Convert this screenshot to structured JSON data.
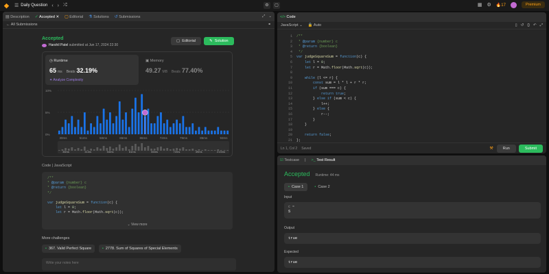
{
  "topbar": {
    "title": "Daily Question",
    "fire_count": "17",
    "premium": "Premium"
  },
  "left_tabs": [
    {
      "label": "Description"
    },
    {
      "label": "Accepted"
    },
    {
      "label": "Editorial"
    },
    {
      "label": "Solutions"
    },
    {
      "label": "Submissions"
    }
  ],
  "all_submissions": "All Submissions",
  "result": {
    "status": "Accepted",
    "user": "Harshil Patel",
    "submitted": "submitted at Jun 17, 2024 22:30",
    "editorial_btn": "Editorial",
    "solution_btn": "Solution"
  },
  "runtime": {
    "label": "Runtime",
    "value": "65",
    "unit": "ms",
    "beats_label": "Beats",
    "beats": "32.19%",
    "analyze": "Analyze Complexity"
  },
  "memory": {
    "label": "Memory",
    "value": "49.27",
    "unit": "MB",
    "beats_label": "Beats",
    "beats": "77.40%"
  },
  "chart_data": {
    "type": "bar",
    "y_ticks": [
      "10%",
      "5%",
      "0%"
    ],
    "x_ticks": [
      "30ms",
      "51ms",
      "58ms",
      "65ms",
      "86ms",
      "72ms",
      "79ms",
      "86ms",
      "93ms"
    ],
    "values": [
      1,
      2,
      4,
      3,
      5,
      2,
      4,
      2,
      6,
      1,
      3,
      2,
      5,
      3,
      7,
      4,
      6,
      3,
      5,
      9,
      4,
      6,
      2,
      7,
      10,
      6,
      11,
      5,
      7,
      3,
      3,
      5,
      6,
      3,
      4,
      2,
      3,
      4,
      3,
      5,
      2,
      2,
      3,
      1,
      2,
      1,
      2,
      1,
      1,
      1,
      2,
      1,
      1,
      1
    ],
    "highlight_index": 27,
    "ylim": [
      0,
      12
    ],
    "mini_x_ticks": [
      "36ms",
      "41ms",
      "54ms",
      "61ms",
      "66ms",
      "72ms",
      "49ms",
      "213ms"
    ]
  },
  "code_section": {
    "label": "Code",
    "lang": "JavaScript",
    "view_more": "View more"
  },
  "more": {
    "label": "More challenges",
    "c1": "367. Valid Perfect Square",
    "c2": "2778. Sum of Squares of Special Elements",
    "notes_placeholder": "Write your notes here"
  },
  "code_panel": {
    "title": "Code",
    "lang": "JavaScript",
    "auto": "Auto",
    "status": "Ln 1, Col 2",
    "saved": "Saved",
    "run": "Run",
    "submit": "Submit"
  },
  "test": {
    "tab1": "Testcase",
    "tab2": "Test Result",
    "status": "Accepted",
    "runtime": "Runtime: 44 ms",
    "case1": "Case 1",
    "case2": "Case 2",
    "input_label": "Input",
    "input_var": "c =",
    "input_val": "5",
    "output_label": "Output",
    "output_val": "true",
    "expected_label": "Expected",
    "expected_val": "true"
  },
  "colors": {
    "accent": "#2cbb5d",
    "brand": "#ffa116",
    "bar": "#1a73e8"
  }
}
